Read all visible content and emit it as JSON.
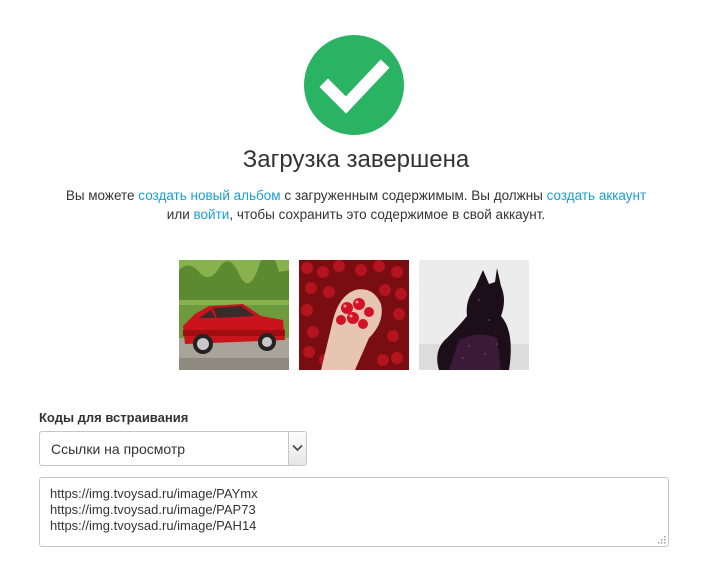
{
  "header": {
    "title": "Загрузка завершена"
  },
  "message": {
    "part1": "Вы можете ",
    "link_create_album": "создать новый альбом",
    "part2": " с загруженным содержимым. Вы должны ",
    "link_create_account": "создать аккаунт",
    "part3": "или ",
    "link_login": "войти",
    "part4": ", чтобы сохранить это содержимое в свой аккаунт."
  },
  "embed": {
    "label": "Коды для встраивания",
    "selected_option": "Ссылки на просмотр",
    "codes": [
      "https://img.tvoysad.ru/image/PAYmx",
      "https://img.tvoysad.ru/image/PAP73",
      "https://img.tvoysad.ru/image/PAH14"
    ]
  },
  "colors": {
    "success": "#2ab362",
    "link": "#1a9ed4",
    "text": "#333333",
    "border": "#c6c6c6"
  },
  "icons": {
    "success": "checkmark-circle-icon",
    "dropdown": "chevron-down-icon"
  }
}
